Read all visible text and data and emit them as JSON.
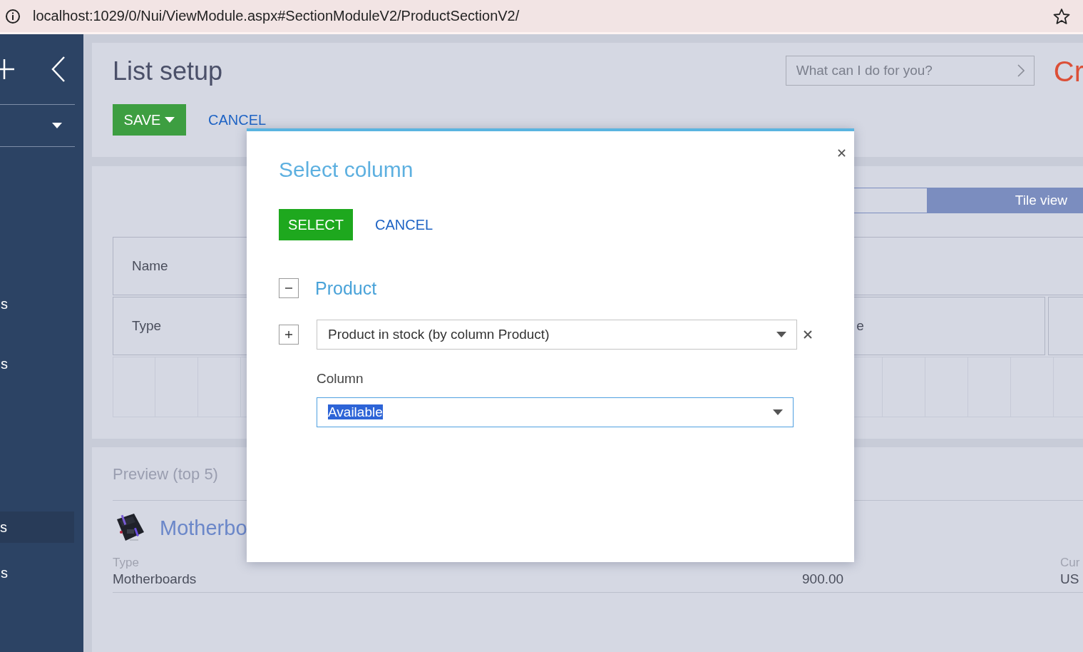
{
  "address_bar": {
    "url": "localhost:1029/0/Nui/ViewModule.aspx#SectionModuleV2/ProductSectionV2/"
  },
  "sidebar": {
    "items": [
      {
        "label": "s",
        "selected": false
      },
      {
        "label": "s",
        "selected": false
      },
      {
        "label": "s",
        "selected": true
      },
      {
        "label": "s",
        "selected": false
      }
    ]
  },
  "header": {
    "title": "List setup",
    "save_button": "SAVE",
    "cancel_link": "CANCEL",
    "search": {
      "placeholder": "What can I do for you?"
    },
    "logo_text": "Cr"
  },
  "setup": {
    "view_toggle": [
      {
        "selected": false
      },
      {
        "label": "Tile view",
        "selected": true
      }
    ],
    "rows": [
      {
        "cells": [
          "Name"
        ]
      },
      {
        "cells": [
          "Type",
          "e"
        ]
      }
    ]
  },
  "preview": {
    "title": "Preview (top 5)",
    "items": [
      {
        "name": "Motherbo",
        "fields": [
          {
            "label": "Type",
            "value": "Motherboards"
          },
          {
            "value": "900.00"
          },
          {
            "label": "Cur",
            "value": "US"
          }
        ]
      }
    ]
  },
  "dialog": {
    "title": "Select column",
    "select_button": "SELECT",
    "cancel_link": "CANCEL",
    "tree": {
      "label": "Product",
      "expanded": true,
      "children": [
        {
          "value": "Product in stock (by column Product)",
          "expanded": false
        }
      ]
    },
    "column_label": "Column",
    "column_value": "Available",
    "column_value_selected": true
  }
}
